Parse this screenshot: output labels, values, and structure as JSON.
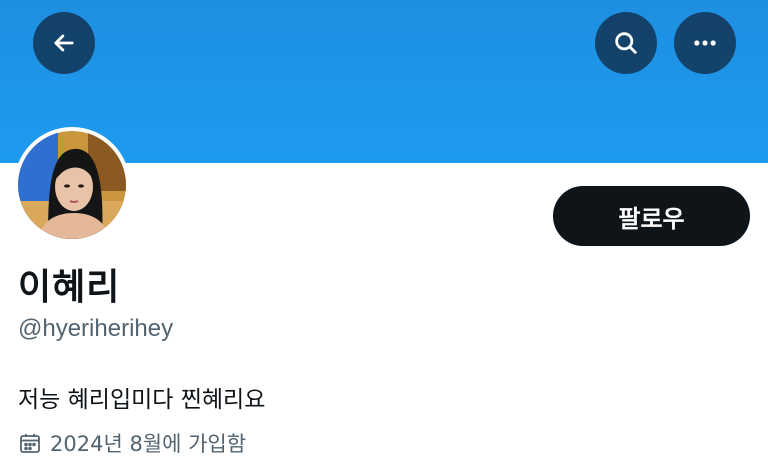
{
  "header": {
    "back_icon": "arrow-left-icon",
    "search_icon": "search-icon",
    "more_icon": "more-horizontal-icon"
  },
  "profile": {
    "display_name": "이혜리",
    "handle": "@hyeriherihey",
    "bio": "저능 혜리입미다 찐혜리요",
    "joined": "2024년 8월에 가입함",
    "joined_icon": "calendar-icon",
    "follow_label": "팔로우"
  },
  "colors": {
    "banner": "#1d9bf0",
    "follow_button": "#0f1419",
    "secondary_text": "#536471"
  }
}
